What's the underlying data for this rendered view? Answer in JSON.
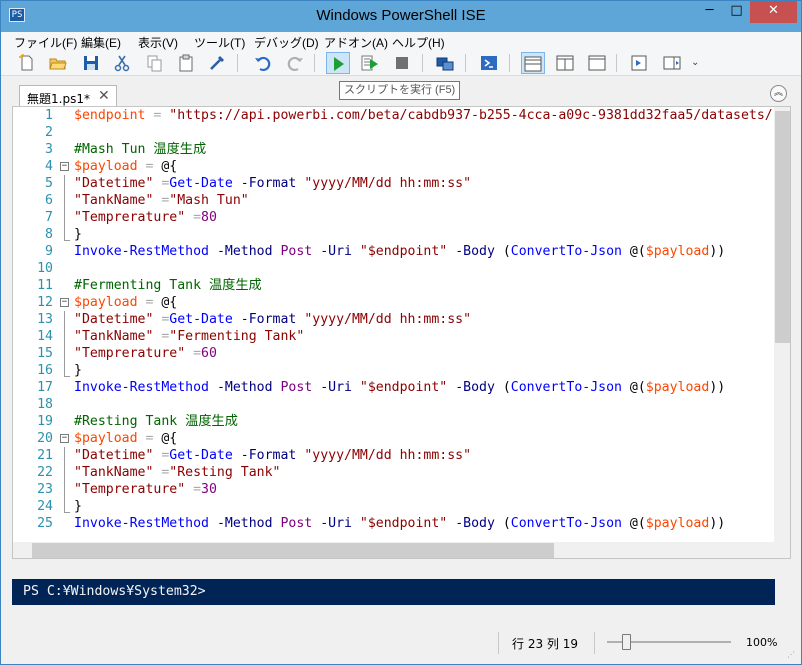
{
  "window": {
    "title": "Windows PowerShell ISE",
    "app_icon": "PS",
    "minimize": "─",
    "maximize": "□",
    "close": "✕"
  },
  "menu": [
    "ファイル(F)",
    "編集(E)",
    "表示(V)",
    "ツール(T)",
    "デバッグ(D)",
    "アドオン(A)",
    "ヘルプ(H)"
  ],
  "toolbar": {
    "icons": [
      "new-file-icon",
      "open-folder-icon",
      "save-icon",
      "cut-icon",
      "copy-icon",
      "paste-icon",
      "clear-console-icon",
      "undo-icon",
      "redo-icon",
      "run-script-icon",
      "run-selection-icon",
      "stop-icon",
      "remote-powershell-icon",
      "powershell-console-icon",
      "layout-script-top-icon",
      "layout-script-right-icon",
      "layout-script-max-icon",
      "show-command-icon",
      "show-addon-icon"
    ],
    "overflow": "⌄",
    "tooltip": "スクリプトを実行 (F5)"
  },
  "tabs": [
    {
      "label": "無題1.ps1*",
      "close": "✕"
    }
  ],
  "collapse_glyph": "︽",
  "editor": {
    "lines": [
      [
        {
          "t": "$endpoint",
          "c": "var"
        },
        {
          "t": " = ",
          "c": "op"
        },
        {
          "t": "\"https://api.powerbi.com/beta/cabdb937-b255-4cca-a09c-9381dd32faa5/datasets/",
          "c": "str"
        }
      ],
      [],
      [
        {
          "t": "#Mash Tun 温度生成",
          "c": "cmt"
        }
      ],
      [
        {
          "t": "$payload",
          "c": "var"
        },
        {
          "t": " = ",
          "c": "op"
        },
        {
          "t": "@{",
          "c": "plain"
        }
      ],
      [
        {
          "t": "\"Datetime\"",
          "c": "str"
        },
        {
          "t": " =",
          "c": "op"
        },
        {
          "t": "Get-Date",
          "c": "cmd"
        },
        {
          "t": " ",
          "c": "plain"
        },
        {
          "t": "-Format",
          "c": "param"
        },
        {
          "t": " ",
          "c": "plain"
        },
        {
          "t": "\"yyyy/MM/dd hh:mm:ss\"",
          "c": "str"
        }
      ],
      [
        {
          "t": "\"TankName\"",
          "c": "str"
        },
        {
          "t": " =",
          "c": "op"
        },
        {
          "t": "\"Mash Tun\"",
          "c": "str"
        }
      ],
      [
        {
          "t": "\"Temprerature\"",
          "c": "str"
        },
        {
          "t": " =",
          "c": "op"
        },
        {
          "t": "80",
          "c": "num"
        }
      ],
      [
        {
          "t": "}",
          "c": "plain"
        }
      ],
      [
        {
          "t": "Invoke-RestMethod",
          "c": "cmd"
        },
        {
          "t": " ",
          "c": "plain"
        },
        {
          "t": "-Method",
          "c": "param"
        },
        {
          "t": " ",
          "c": "plain"
        },
        {
          "t": "Post",
          "c": "num"
        },
        {
          "t": " ",
          "c": "plain"
        },
        {
          "t": "-Uri",
          "c": "param"
        },
        {
          "t": " ",
          "c": "plain"
        },
        {
          "t": "\"$endpoint\"",
          "c": "str"
        },
        {
          "t": " ",
          "c": "plain"
        },
        {
          "t": "-Body",
          "c": "param"
        },
        {
          "t": " (",
          "c": "plain"
        },
        {
          "t": "ConvertTo-Json",
          "c": "cmd"
        },
        {
          "t": " @(",
          "c": "plain"
        },
        {
          "t": "$payload",
          "c": "var"
        },
        {
          "t": "))",
          "c": "plain"
        }
      ],
      [],
      [
        {
          "t": "#Fermenting Tank 温度生成",
          "c": "cmt"
        }
      ],
      [
        {
          "t": "$payload",
          "c": "var"
        },
        {
          "t": " = ",
          "c": "op"
        },
        {
          "t": "@{",
          "c": "plain"
        }
      ],
      [
        {
          "t": "\"Datetime\"",
          "c": "str"
        },
        {
          "t": " =",
          "c": "op"
        },
        {
          "t": "Get-Date",
          "c": "cmd"
        },
        {
          "t": " ",
          "c": "plain"
        },
        {
          "t": "-Format",
          "c": "param"
        },
        {
          "t": " ",
          "c": "plain"
        },
        {
          "t": "\"yyyy/MM/dd hh:mm:ss\"",
          "c": "str"
        }
      ],
      [
        {
          "t": "\"TankName\"",
          "c": "str"
        },
        {
          "t": " =",
          "c": "op"
        },
        {
          "t": "\"Fermenting Tank\"",
          "c": "str"
        }
      ],
      [
        {
          "t": "\"Temprerature\"",
          "c": "str"
        },
        {
          "t": " =",
          "c": "op"
        },
        {
          "t": "60",
          "c": "num"
        }
      ],
      [
        {
          "t": "}",
          "c": "plain"
        }
      ],
      [
        {
          "t": "Invoke-RestMethod",
          "c": "cmd"
        },
        {
          "t": " ",
          "c": "plain"
        },
        {
          "t": "-Method",
          "c": "param"
        },
        {
          "t": " ",
          "c": "plain"
        },
        {
          "t": "Post",
          "c": "num"
        },
        {
          "t": " ",
          "c": "plain"
        },
        {
          "t": "-Uri",
          "c": "param"
        },
        {
          "t": " ",
          "c": "plain"
        },
        {
          "t": "\"$endpoint\"",
          "c": "str"
        },
        {
          "t": " ",
          "c": "plain"
        },
        {
          "t": "-Body",
          "c": "param"
        },
        {
          "t": " (",
          "c": "plain"
        },
        {
          "t": "ConvertTo-Json",
          "c": "cmd"
        },
        {
          "t": " @(",
          "c": "plain"
        },
        {
          "t": "$payload",
          "c": "var"
        },
        {
          "t": "))",
          "c": "plain"
        }
      ],
      [],
      [
        {
          "t": "#Resting Tank 温度生成",
          "c": "cmt"
        }
      ],
      [
        {
          "t": "$payload",
          "c": "var"
        },
        {
          "t": " = ",
          "c": "op"
        },
        {
          "t": "@{",
          "c": "plain"
        }
      ],
      [
        {
          "t": "\"Datetime\"",
          "c": "str"
        },
        {
          "t": " =",
          "c": "op"
        },
        {
          "t": "Get-Date",
          "c": "cmd"
        },
        {
          "t": " ",
          "c": "plain"
        },
        {
          "t": "-Format",
          "c": "param"
        },
        {
          "t": " ",
          "c": "plain"
        },
        {
          "t": "\"yyyy/MM/dd hh:mm:ss\"",
          "c": "str"
        }
      ],
      [
        {
          "t": "\"TankName\"",
          "c": "str"
        },
        {
          "t": " =",
          "c": "op"
        },
        {
          "t": "\"Resting Tank\"",
          "c": "str"
        }
      ],
      [
        {
          "t": "\"Temprerature\"",
          "c": "str"
        },
        {
          "t": " =",
          "c": "op"
        },
        {
          "t": "30",
          "c": "num"
        }
      ],
      [
        {
          "t": "}",
          "c": "plain"
        }
      ],
      [
        {
          "t": "Invoke-RestMethod",
          "c": "cmd"
        },
        {
          "t": " ",
          "c": "plain"
        },
        {
          "t": "-Method",
          "c": "param"
        },
        {
          "t": " ",
          "c": "plain"
        },
        {
          "t": "Post",
          "c": "num"
        },
        {
          "t": " ",
          "c": "plain"
        },
        {
          "t": "-Uri",
          "c": "param"
        },
        {
          "t": " ",
          "c": "plain"
        },
        {
          "t": "\"$endpoint\"",
          "c": "str"
        },
        {
          "t": " ",
          "c": "plain"
        },
        {
          "t": "-Body",
          "c": "param"
        },
        {
          "t": " (",
          "c": "plain"
        },
        {
          "t": "ConvertTo-Json",
          "c": "cmd"
        },
        {
          "t": " @(",
          "c": "plain"
        },
        {
          "t": "$payload",
          "c": "var"
        },
        {
          "t": "))",
          "c": "plain"
        }
      ]
    ],
    "fold_glyph": "−"
  },
  "console": {
    "prompt": "PS C:¥Windows¥System32>"
  },
  "status": {
    "position": "行 23 列 19",
    "zoom": "100%",
    "zoom_fraction": 0.15,
    "grip": "⋰"
  },
  "colors": {
    "titlebar": "#5fa6d8",
    "console_bg": "#012456",
    "close_button": "#c75050"
  }
}
